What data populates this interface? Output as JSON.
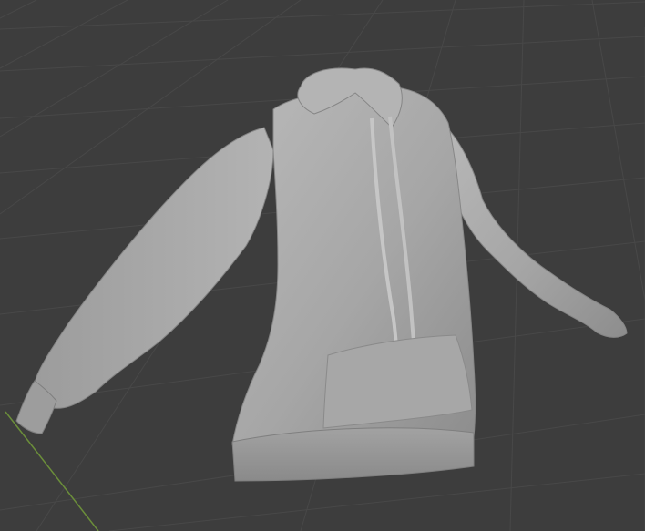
{
  "viewport": {
    "background_color": "#3d3d3d",
    "grid_line_color": "#4a4a4a",
    "axis_y_color": "#6b8e3a"
  },
  "model": {
    "name": "hoodie",
    "material_color": "#a8a8a8"
  }
}
